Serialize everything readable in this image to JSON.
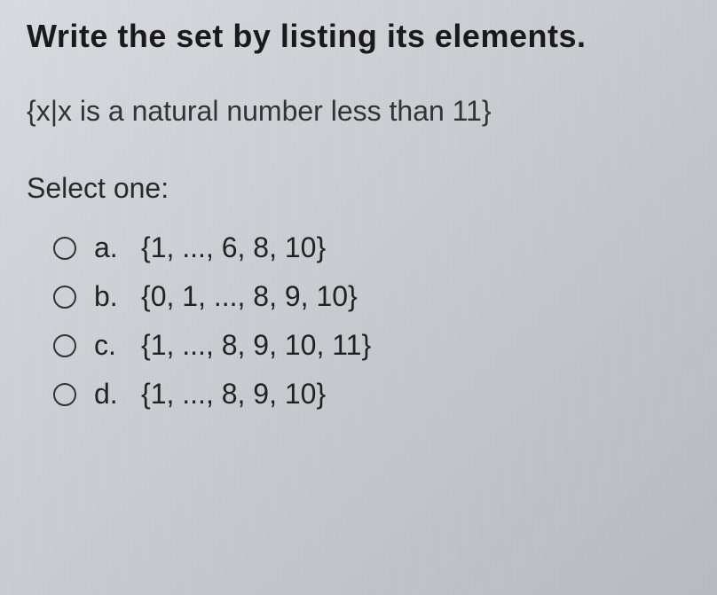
{
  "question": {
    "title": "Write the set by listing its elements.",
    "set_notation": "{x|x is a natural number less than 11}",
    "prompt": "Select one:"
  },
  "options": [
    {
      "letter": "a.",
      "text": "{1, ..., 6, 8, 10}"
    },
    {
      "letter": "b.",
      "text": "{0, 1, ..., 8, 9, 10}"
    },
    {
      "letter": "c.",
      "text": "{1, ..., 8, 9, 10, 11}"
    },
    {
      "letter": "d.",
      "text": "{1, ..., 8, 9, 10}"
    }
  ]
}
